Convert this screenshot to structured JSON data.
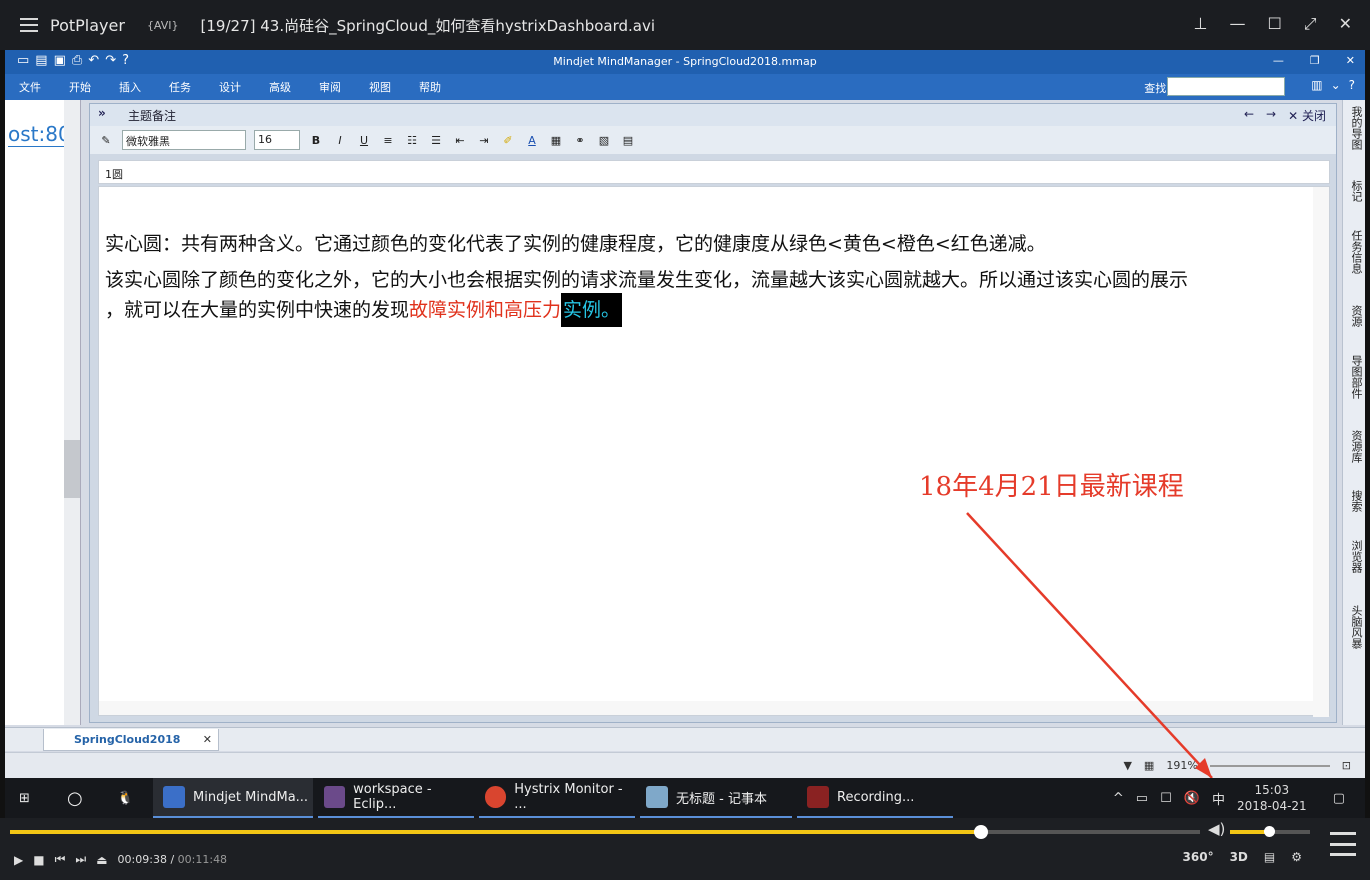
{
  "player": {
    "app_name": "PotPlayer",
    "format": "{AVI}",
    "file_title": "[19/27] 43.尚硅谷_SpringCloud_如何查看hystrixDashboard.avi",
    "current_time": "00:09:38",
    "total_time": "00:11:48",
    "progress": 0.816,
    "volume": 0.5,
    "btn_360": "360°",
    "btn_3d": "3D"
  },
  "mm": {
    "window_title": "Mindjet MindManager - SpringCloud2018.mmap",
    "ribbon_tabs": [
      "文件",
      "开始",
      "插入",
      "任务",
      "设计",
      "高级",
      "审阅",
      "视图",
      "帮助"
    ],
    "find_label": "查找:",
    "left_url_text": "ost:80",
    "notes_panel_title": "主题备注",
    "close_label": "关闭",
    "font_name": "微软雅黑",
    "font_size": "16",
    "topic_title": "1圆",
    "para1": "实心圆：共有两种含义。它通过颜色的变化代表了实例的健康程度，它的健康度从绿色<黄色<橙色<红色递减。",
    "para2_line1": "该实心圆除了颜色的变化之外，它的大小也会根据实例的请求流量发生变化，流量越大该实心圆就越大。所以通过该实心圆的展示",
    "para2_line2_a": "，就可以在大量的实例中快速的发现",
    "para2_line2_red": "故障实例和高压力",
    "para2_line2_sel": "实例。",
    "doc_tab": "SpringCloud2018",
    "zoom": "191%",
    "rail_items": [
      "我的导图",
      "标记",
      "任务信息",
      "资源",
      "导图部件",
      "资源库",
      "搜索",
      "浏览器",
      "头脑风暴"
    ]
  },
  "annotation": "18年4月21日最新课程",
  "taskbar": {
    "apps": [
      "Mindjet MindMa...",
      "workspace - Eclip...",
      "Hystrix Monitor - ...",
      "无标题 - 记事本",
      "Recording..."
    ],
    "ime": "中",
    "time": "15:03",
    "date": "2018-04-21"
  },
  "colors": {
    "accent": "#f2c515",
    "mm_blue": "#2060b0",
    "annotation_red": "#e53b2a"
  }
}
